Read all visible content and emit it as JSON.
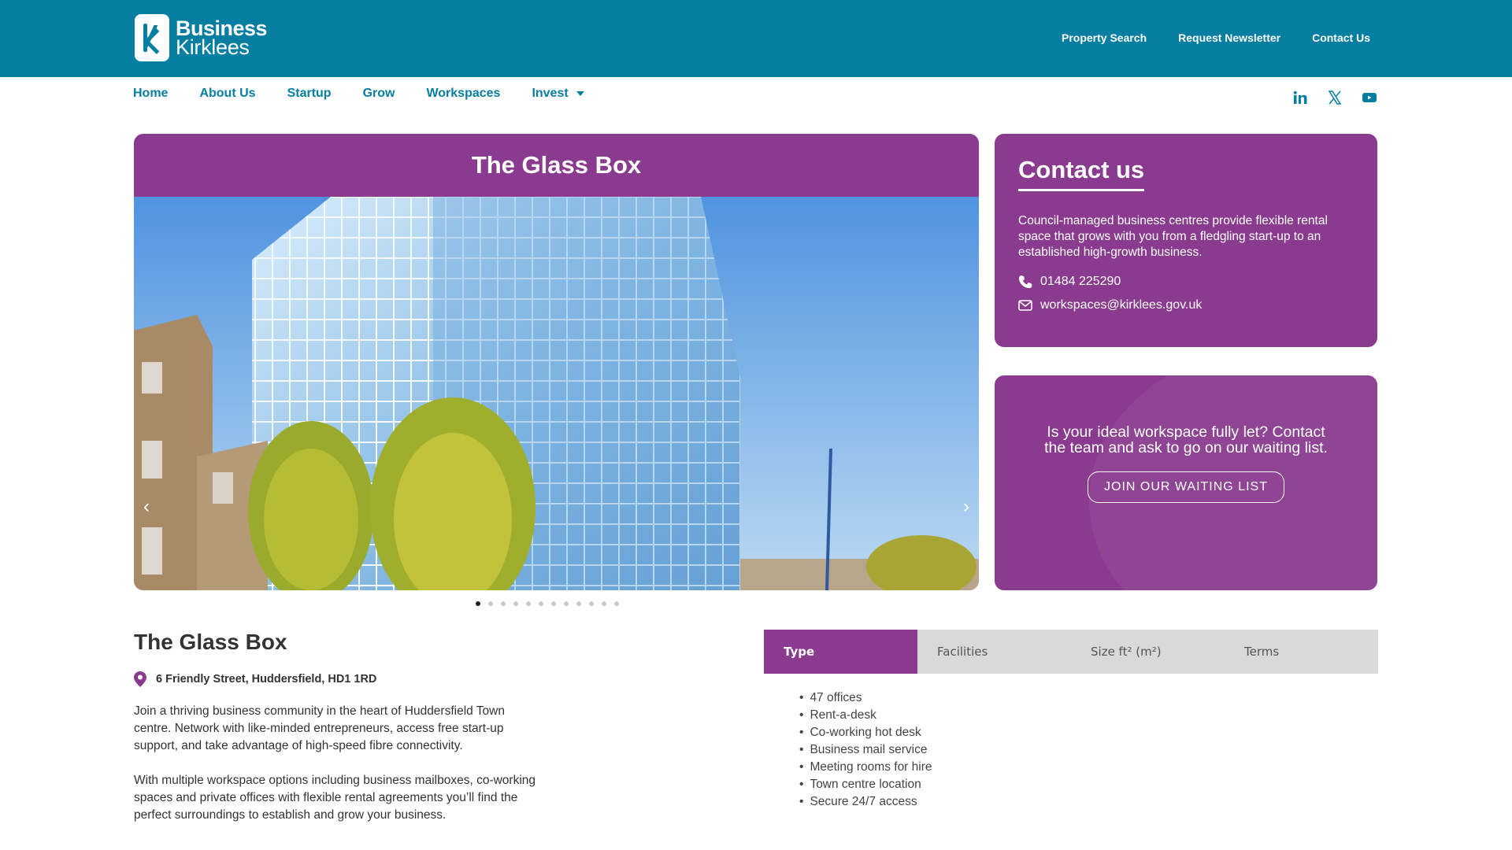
{
  "header": {
    "logo_line1": "Business",
    "logo_line2": "Kirklees",
    "links": [
      "Property Search",
      "Request Newsletter",
      "Contact Us"
    ]
  },
  "nav": {
    "items": [
      "Home",
      "About Us",
      "Startup",
      "Grow",
      "Workspaces",
      "Invest"
    ]
  },
  "social": {
    "icons": [
      "linkedin-icon",
      "x-icon",
      "youtube-icon"
    ]
  },
  "hero": {
    "title": "The Glass Box",
    "slide_count": 12,
    "active_slide": 1
  },
  "contact": {
    "title": "Contact us",
    "description": "Council-managed business centres provide flexible rental space that grows with you from a fledgling start-up to an established high-growth business.",
    "phone": "01484 225290",
    "email": "workspaces@kirklees.gov.uk"
  },
  "waiting": {
    "message": "Is your ideal workspace fully let? Contact the team and ask to go on our waiting list.",
    "button": "JOIN OUR WAITING LIST"
  },
  "details": {
    "title": "The Glass Box",
    "address": "6 Friendly Street, Huddersfield, HD1 1RD",
    "para1": "Join a thriving business community in the heart of Huddersfield Town centre.  Network with like-minded entrepreneurs, access free start-up support, and take advantage of high-speed fibre connectivity.",
    "para2": "With multiple workspace options including business mailboxes, co-working spaces and private offices with flexible rental agreements you’ll find the perfect surroundings to establish and grow your business."
  },
  "tabs": [
    "Type",
    "Facilities",
    "Size ft² (m²)",
    "Terms"
  ],
  "features": [
    "47 offices",
    "Rent-a-desk",
    "Co-working hot desk",
    "Business mail service",
    "Meeting rooms for hire",
    "Town centre location",
    "Secure 24/7 access"
  ],
  "colors": {
    "teal": "#057ea1",
    "purple": "#8b3b8f"
  }
}
